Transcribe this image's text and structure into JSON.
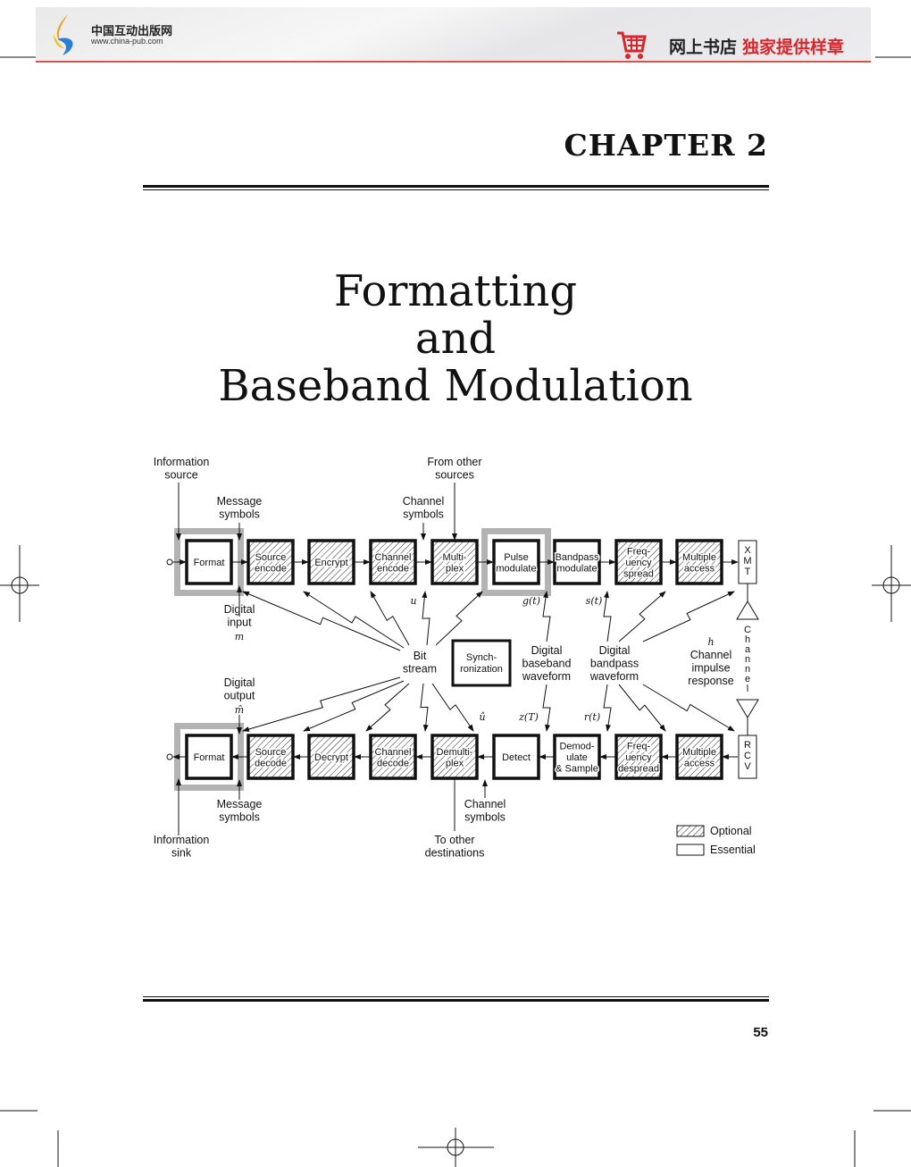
{
  "header": {
    "logo_cn": "中国互动出版网",
    "logo_url": "www.china-pub.com",
    "shop_label": "网上书店",
    "shop_tagline": "独家提供样章",
    "accent": "#d8262c"
  },
  "chapter": "CHAPTER  2",
  "title": [
    "Formatting",
    "and",
    "Baseband Modulation"
  ],
  "page_number": "55",
  "diagram": {
    "tx_blocks": [
      {
        "lines": [
          "Format"
        ],
        "type": "essential",
        "highlight": true
      },
      {
        "lines": [
          "Source",
          "encode"
        ],
        "type": "optional"
      },
      {
        "lines": [
          "Encrypt"
        ],
        "type": "optional"
      },
      {
        "lines": [
          "Channel",
          "encode"
        ],
        "type": "optional"
      },
      {
        "lines": [
          "Multi-",
          "plex"
        ],
        "type": "optional"
      },
      {
        "lines": [
          "Pulse",
          "modulate"
        ],
        "type": "essential",
        "highlight": true
      },
      {
        "lines": [
          "Bandpass",
          "modulate"
        ],
        "type": "essential"
      },
      {
        "lines": [
          "Freq-",
          "uency",
          "spread"
        ],
        "type": "optional"
      },
      {
        "lines": [
          "Multiple",
          "access"
        ],
        "type": "optional"
      }
    ],
    "rx_blocks": [
      {
        "lines": [
          "Format"
        ],
        "type": "essential",
        "highlight": true
      },
      {
        "lines": [
          "Source",
          "decode"
        ],
        "type": "optional"
      },
      {
        "lines": [
          "Decrypt"
        ],
        "type": "optional"
      },
      {
        "lines": [
          "Channel",
          "decode"
        ],
        "type": "optional"
      },
      {
        "lines": [
          "Demulti-",
          "plex"
        ],
        "type": "optional"
      },
      {
        "lines": [
          "Detect"
        ],
        "type": "essential"
      },
      {
        "lines": [
          "Demod-",
          "ulate",
          "& Sample"
        ],
        "type": "essential"
      },
      {
        "lines": [
          "Freq-",
          "uency",
          "despread"
        ],
        "type": "optional"
      },
      {
        "lines": [
          "Multiple",
          "access"
        ],
        "type": "optional"
      }
    ],
    "xmt": [
      "X",
      "M",
      "T"
    ],
    "rcv": [
      "R",
      "C",
      "V"
    ],
    "channel_letters": [
      "C",
      "h",
      "a",
      "n",
      "n",
      "e",
      "l"
    ],
    "synch": [
      "Synch-",
      "ronization"
    ],
    "labels": {
      "info_source": [
        "Information",
        "source"
      ],
      "from_other": [
        "From other",
        "sources"
      ],
      "msg_symbols_top": [
        "Message",
        "symbols"
      ],
      "ch_symbols_top": [
        "Channel",
        "symbols"
      ],
      "digital_input": [
        "Digital",
        "input"
      ],
      "mi": "m",
      "bit_stream": [
        "Bit",
        "stream"
      ],
      "digital_baseband": [
        "Digital",
        "baseband",
        "waveform"
      ],
      "digital_bandpass": [
        "Digital",
        "bandpass",
        "waveform"
      ],
      "hc": "h",
      "channel_impulse": [
        "Channel",
        "impulse",
        "response"
      ],
      "digital_output": [
        "Digital",
        "output"
      ],
      "mhat": "m̂",
      "ui": "u",
      "uhat": "û",
      "gi": "g(t)",
      "si": "s(t)",
      "zT": "z(T)",
      "rt": "r(t)",
      "msg_symbols_bottom": [
        "Message",
        "symbols"
      ],
      "info_sink": [
        "Information",
        "sink"
      ],
      "ch_symbols_bottom": [
        "Channel",
        "symbols"
      ],
      "to_other": [
        "To other",
        "destinations"
      ]
    },
    "legend": {
      "optional": "Optional",
      "essential": "Essential"
    }
  }
}
